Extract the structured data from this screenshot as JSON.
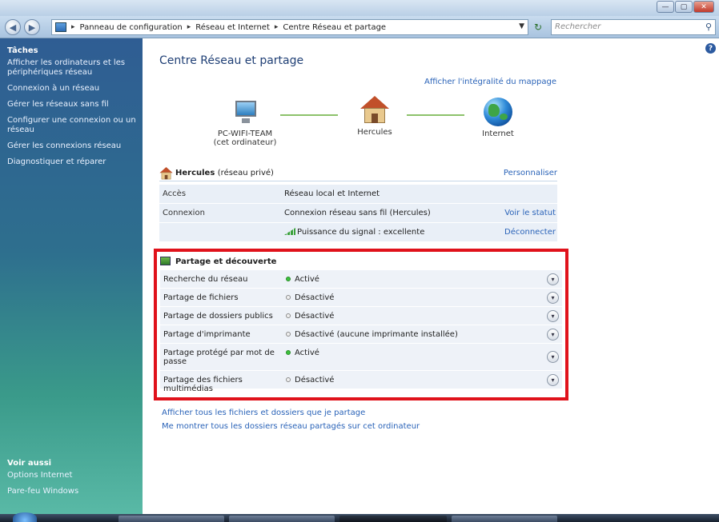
{
  "window": {
    "buttons": {
      "minimize": "—",
      "maximize": "▢",
      "close": "✕"
    }
  },
  "address_bar": {
    "crumbs": [
      "Panneau de configuration",
      "Réseau et Internet",
      "Centre Réseau et partage"
    ],
    "search_placeholder": "Rechercher"
  },
  "sidebar": {
    "tasks_heading": "Tâches",
    "tasks": [
      "Afficher les ordinateurs et les périphériques réseau",
      "Connexion à un réseau",
      "Gérer les réseaux sans fil",
      "Configurer une connexion ou un réseau",
      "Gérer les connexions réseau",
      "Diagnostiquer et réparer"
    ],
    "see_also_heading": "Voir aussi",
    "see_also": [
      "Options Internet",
      "Pare-feu Windows"
    ]
  },
  "main": {
    "title": "Centre Réseau et partage",
    "full_map_link": "Afficher l'intégralité du mappage",
    "map": {
      "computer_name": "PC-WIFI-TEAM",
      "computer_sub": "(cet ordinateur)",
      "network": "Hercules",
      "internet": "Internet"
    },
    "network": {
      "name": "Hercules",
      "type": "(réseau privé)",
      "customize": "Personnaliser",
      "rows": [
        {
          "label": "Accès",
          "value": "Réseau local et Internet",
          "action": ""
        },
        {
          "label": "Connexion",
          "value": "Connexion réseau sans fil (Hercules)",
          "action": "Voir le statut"
        },
        {
          "label": "",
          "value": "Puissance du signal : excellente",
          "action": "Déconnecter"
        }
      ]
    },
    "sharing": {
      "heading": "Partage et découverte",
      "rows": [
        {
          "label": "Recherche du réseau",
          "status": "Activé",
          "on": true
        },
        {
          "label": "Partage de fichiers",
          "status": "Désactivé",
          "on": false
        },
        {
          "label": "Partage de dossiers publics",
          "status": "Désactivé",
          "on": false
        },
        {
          "label": "Partage d'imprimante",
          "status": "Désactivé (aucune imprimante installée)",
          "on": false
        },
        {
          "label": "Partage protégé par mot de passe",
          "status": "Activé",
          "on": true
        },
        {
          "label": "Partage des fichiers multimédias",
          "status": "Désactivé",
          "on": false
        }
      ]
    },
    "bottom_links": [
      "Afficher tous les fichiers et dossiers que je partage",
      "Me montrer tous les dossiers réseau partagés sur cet ordinateur"
    ]
  },
  "colors": {
    "accent_link": "#2a63b8",
    "highlight_border": "#e0121b",
    "status_on": "#3cc23c"
  }
}
